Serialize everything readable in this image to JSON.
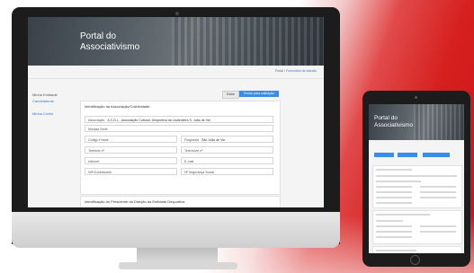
{
  "colors": {
    "accent": "#3a8ee6",
    "link": "#3a78c3",
    "brand_red": "#d61f1f"
  },
  "desktop": {
    "brand_line1": "Portal do",
    "brand_line2": "Associativismo",
    "breadcrumb_home": "Portal",
    "breadcrumb_current": "Formulário de adesão",
    "sidebar_title": "Minha Entidade",
    "sidebar_items": [
      "Candidaturas",
      "Minha Conta"
    ],
    "edit_button": "Editar",
    "submit_button": "Enviar para validação",
    "section1_title": "Identificação da Associação/Coletividade",
    "fields": [
      {
        "label": "Associação",
        "value": "A.C.D.L - Associação Cultural, Desportiva da Lavandeira S. João de Ver"
      },
      {
        "label": "Morada Sede",
        "value": ""
      },
      {
        "label": "Código Postal",
        "value": "-"
      },
      {
        "label": "Freguesia",
        "value": "São João de Ver"
      },
      {
        "label": "Telefone nº",
        "value": ""
      },
      {
        "label": "Telemóvel nº",
        "value": ""
      },
      {
        "label": "Internet",
        "value": ""
      },
      {
        "label": "E-mail",
        "value": ""
      },
      {
        "label": "NIF/Contribuinte",
        "value": ""
      },
      {
        "label": "Nº Segurança Social",
        "value": ""
      }
    ],
    "section2_title": "Identificação do Presidente da Direção da Entidade Desportiva"
  },
  "tablet": {
    "brand_line1": "Portal do",
    "brand_line2": "Associativismo"
  }
}
